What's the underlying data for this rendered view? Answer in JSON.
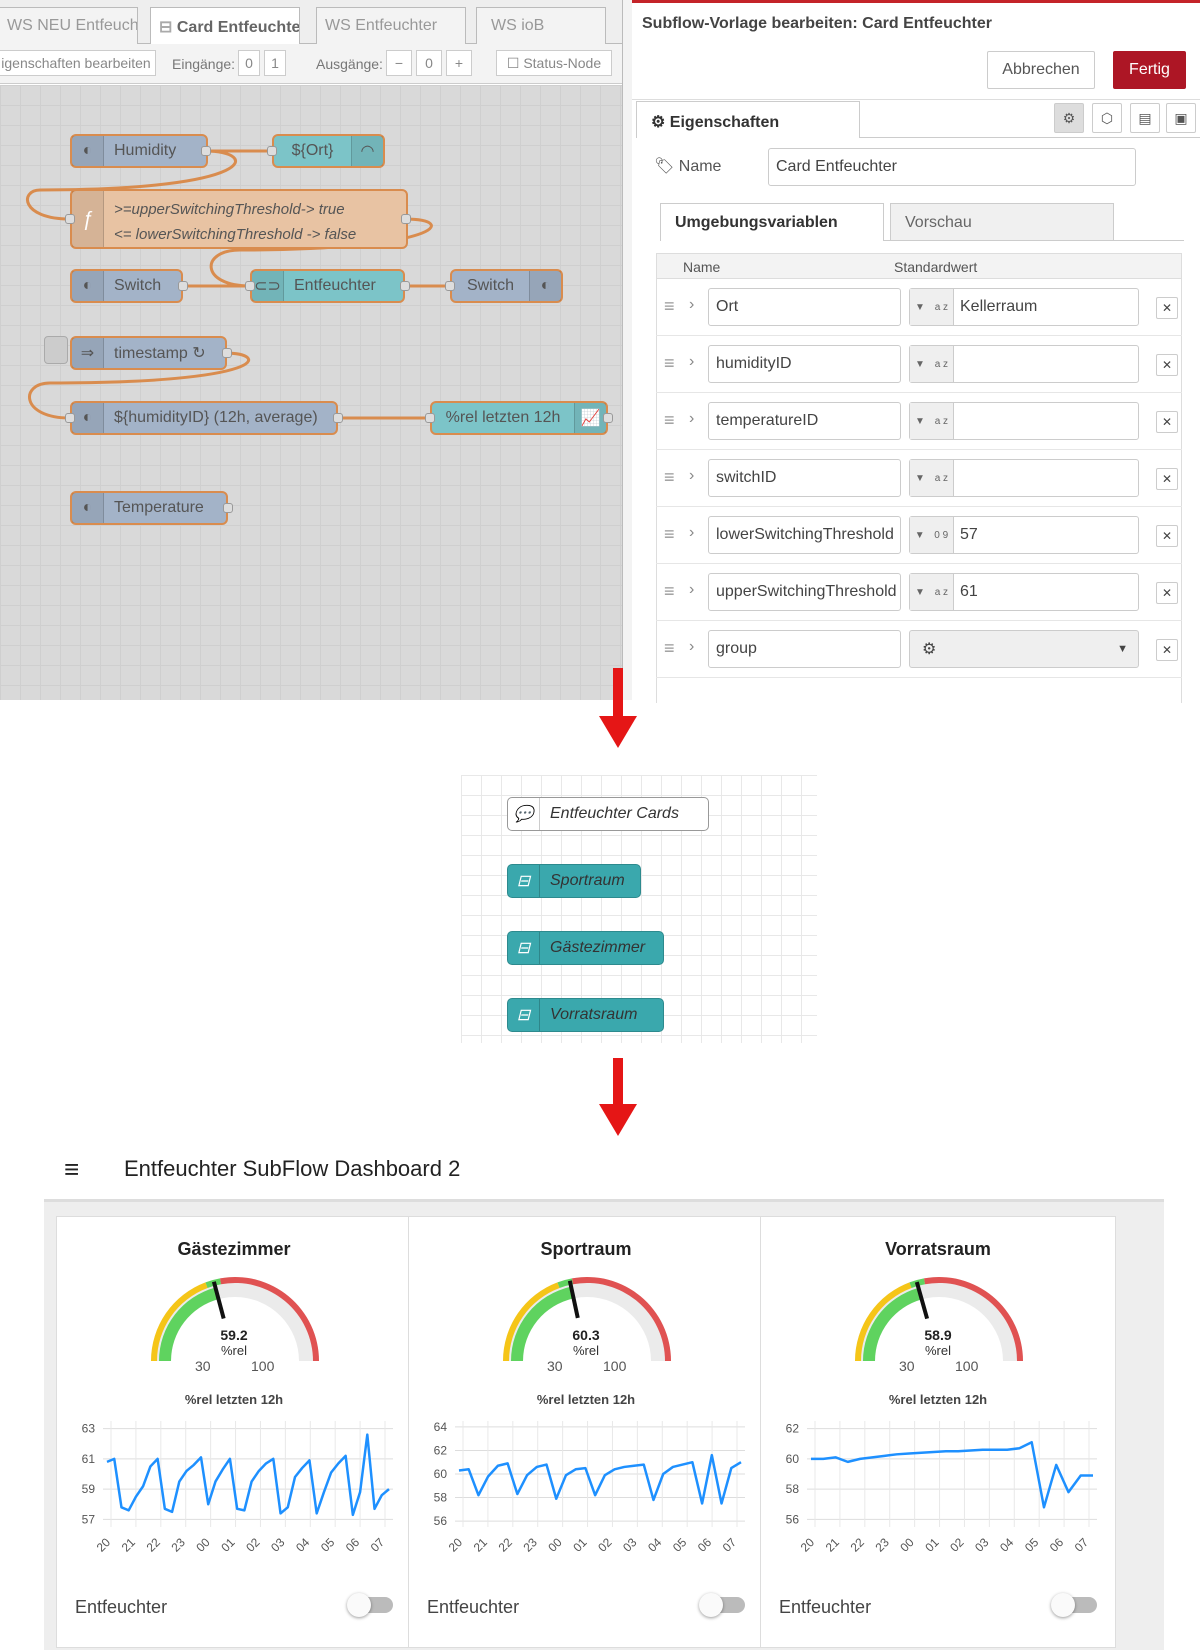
{
  "editor": {
    "tabs": [
      "WS NEU Entfeuchte",
      "Card Entfeuchte",
      "WS Entfeuchter",
      "WS ioB"
    ],
    "toolbar": {
      "edit_props": "igenschaften bearbeiten",
      "inputs_label": "Eingänge:",
      "inputs_values": [
        "0",
        "1"
      ],
      "outputs_label": "Ausgänge:",
      "outputs_minus": "−",
      "outputs_value": "0",
      "outputs_plus": "+",
      "status_node": "Status-Node"
    },
    "nodes": {
      "humidity": "Humidity",
      "ort": "${Ort}",
      "function_line1": ">=upperSwitchingThreshold-> true",
      "function_line2": "<= lowerSwitchingThreshold -> false",
      "switch_in": "Switch",
      "entfeuchter": "Entfeuchter",
      "switch_out": "Switch",
      "timestamp": "timestamp ↻",
      "history": "${humidityID} (12h, average)",
      "chart": "%rel letzten 12h",
      "temperature": "Temperature"
    }
  },
  "tray": {
    "title": "Subflow-Vorlage bearbeiten: Card Entfeuchter",
    "cancel": "Abbrechen",
    "done": "Fertig",
    "properties_tab": "Eigenschaften",
    "name_label": "Name",
    "name_value": "Card Entfeuchter",
    "env_tab": "Umgebungsvariablen",
    "preview_tab": "Vorschau",
    "col_name": "Name",
    "col_default": "Standardwert",
    "env": [
      {
        "name": "Ort",
        "type": "a z",
        "value": "Kellerraum"
      },
      {
        "name": "humidityID",
        "type": "a z",
        "value": ""
      },
      {
        "name": "temperatureID",
        "type": "a z",
        "value": ""
      },
      {
        "name": "switchID",
        "type": "a z",
        "value": ""
      },
      {
        "name": "lowerSwitchingThreshold",
        "type": "0 9",
        "value": "57"
      },
      {
        "name": "upperSwitchingThreshold",
        "type": "a z",
        "value": "61"
      },
      {
        "name": "group",
        "type": "gear",
        "value": ""
      }
    ]
  },
  "flow": {
    "comment": "Entfeuchter Cards",
    "instances": [
      "Sportraum",
      "Gästezimmer",
      "Vorratsraum"
    ]
  },
  "dashboard": {
    "title": "Entfeuchter SubFlow Dashboard 2",
    "cards": [
      {
        "title": "Gästezimmer",
        "gauge_value": "59.2",
        "unit": "%rel",
        "min": "30",
        "max": "100",
        "chart_title": "%rel letzten 12h",
        "switch_label": "Entfeuchter",
        "switch_on": false
      },
      {
        "title": "Sportraum",
        "gauge_value": "60.3",
        "unit": "%rel",
        "min": "30",
        "max": "100",
        "chart_title": "%rel letzten 12h",
        "switch_label": "Entfeuchter",
        "switch_on": false
      },
      {
        "title": "Vorratsraum",
        "gauge_value": "58.9",
        "unit": "%rel",
        "min": "30",
        "max": "100",
        "chart_title": "%rel letzten 12h",
        "switch_label": "Entfeuchter",
        "switch_on": false
      }
    ]
  },
  "colors": {
    "accent": "#ad1625",
    "gauge_green": "#5fd35f",
    "gauge_yellow": "#f5c518",
    "gauge_red": "#e05252",
    "line": "#1e90ff"
  },
  "chart_data": [
    {
      "type": "line",
      "title": "%rel letzten 12h",
      "x": [
        "20",
        "21",
        "22",
        "23",
        "00",
        "01",
        "02",
        "03",
        "04",
        "05",
        "06",
        "07"
      ],
      "ylim": [
        56.5,
        63.5
      ],
      "yticks": [
        57,
        59,
        61,
        63
      ],
      "series": [
        {
          "values": [
            60.8,
            61.0,
            57.8,
            57.6,
            58.5,
            59.2,
            60.5,
            61.0,
            57.7,
            57.5,
            59.5,
            60.2,
            60.6,
            61.1,
            58.0,
            59.5,
            60.3,
            61.0,
            57.7,
            57.6,
            59.5,
            60.2,
            60.7,
            61.0,
            57.4,
            57.8,
            59.8,
            60.4,
            60.9,
            57.4,
            58.8,
            60.1,
            60.7,
            61.2,
            57.3,
            58.8,
            62.6,
            57.7,
            58.6,
            59.0
          ]
        }
      ]
    },
    {
      "type": "line",
      "title": "%rel letzten 12h",
      "x": [
        "20",
        "21",
        "22",
        "23",
        "00",
        "01",
        "02",
        "03",
        "04",
        "05",
        "06",
        "07"
      ],
      "ylim": [
        55.5,
        64.5
      ],
      "yticks": [
        56,
        58,
        60,
        62,
        64
      ],
      "series": [
        {
          "values": [
            60.3,
            60.4,
            58.2,
            59.8,
            60.7,
            60.9,
            58.3,
            59.9,
            60.6,
            60.8,
            57.9,
            59.9,
            60.4,
            60.5,
            58.2,
            59.9,
            60.4,
            60.6,
            60.7,
            60.8,
            57.8,
            60.0,
            60.6,
            60.8,
            61.0,
            57.5,
            61.6,
            57.5,
            60.5,
            61.0
          ]
        }
      ]
    },
    {
      "type": "line",
      "title": "%rel letzten 12h",
      "x": [
        "20",
        "21",
        "22",
        "23",
        "00",
        "01",
        "02",
        "03",
        "04",
        "05",
        "06",
        "07"
      ],
      "ylim": [
        55.5,
        62.5
      ],
      "yticks": [
        56,
        58,
        60,
        62
      ],
      "series": [
        {
          "values": [
            60.0,
            60.0,
            60.1,
            59.8,
            60.0,
            60.1,
            60.2,
            60.3,
            60.35,
            60.4,
            60.45,
            60.5,
            60.5,
            60.55,
            60.6,
            60.6,
            60.6,
            60.7,
            61.1,
            56.8,
            59.6,
            57.8,
            58.9,
            58.9
          ]
        }
      ]
    }
  ]
}
